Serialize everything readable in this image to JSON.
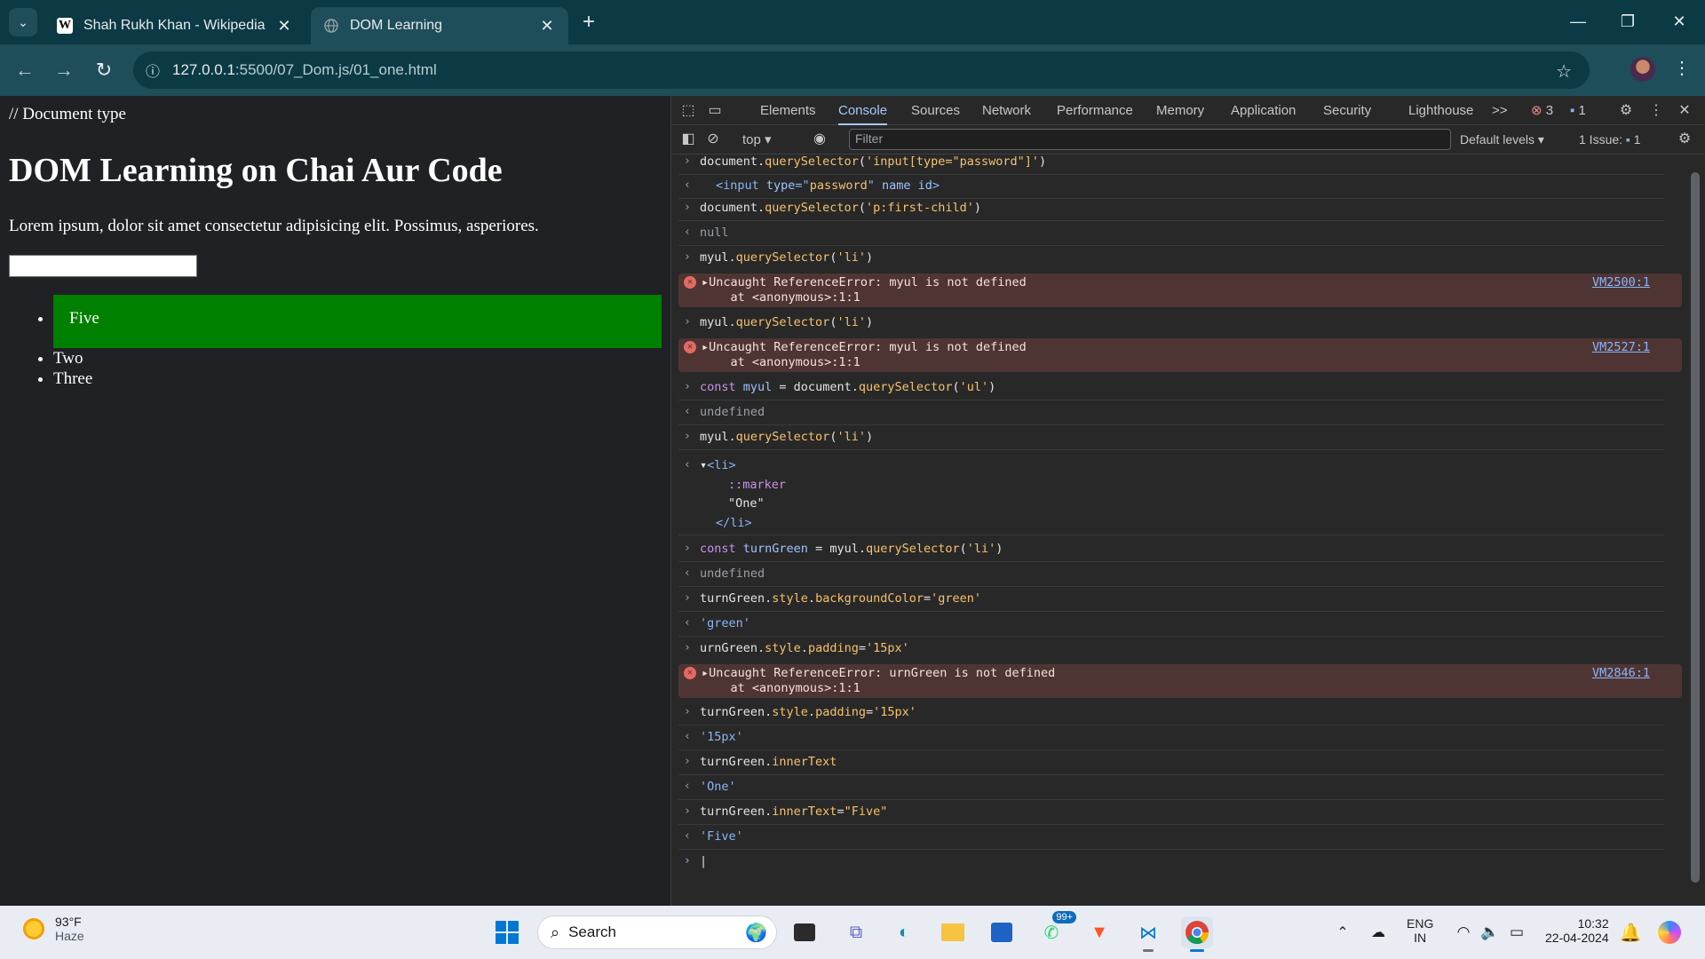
{
  "browser": {
    "tabs": [
      {
        "title": "Shah Rukh Khan - Wikipedia",
        "favicon": "W",
        "active": false
      },
      {
        "title": "DOM Learning",
        "favicon": "globe-icon",
        "active": true
      }
    ],
    "url_host": "127.0.0.1",
    "url_path": ":5500/07_Dom.js/01_one.html"
  },
  "page": {
    "doctype_text": "// Document type",
    "heading": "DOM Learning on Chai Aur Code",
    "paragraph": "Lorem ipsum, dolor sit amet consectetur adipisicing elit. Possimus, asperiores.",
    "list": [
      "Five",
      "Two",
      "Three"
    ],
    "first_item_bg": "#008000"
  },
  "devtools": {
    "tabs": [
      "Elements",
      "Console",
      "Sources",
      "Network",
      "Performance",
      "Memory",
      "Application",
      "Security",
      "Lighthouse"
    ],
    "more": ">>",
    "error_count": "3",
    "message_count": "1",
    "context": "top",
    "filter_placeholder": "Filter",
    "levels": "Default levels",
    "issues_label": "1 Issue:",
    "issues_count": "1",
    "console": {
      "r1": {
        "a": "document.",
        "b": "querySelector",
        "c": "(",
        "d": "'input[type=\"password\"]'",
        "e": ")"
      },
      "r2": {
        "a": "<input ",
        "b": "type",
        "c": "=\"",
        "d": "password",
        "e": "\" ",
        "f": "name id",
        "g": ">"
      },
      "r3": {
        "a": "document.",
        "b": "querySelector",
        "c": "(",
        "d": "'p:first-child'",
        "e": ")"
      },
      "r4": "null",
      "r5": {
        "a": "myul.",
        "b": "querySelector",
        "c": "(",
        "d": "'li'",
        "e": ")"
      },
      "e1": {
        "line1": "Uncaught ReferenceError: myul is not defined",
        "line2": "    at <anonymous>:1:1",
        "link": "VM2500:1"
      },
      "r6": {
        "a": "myul.",
        "b": "querySelector",
        "c": "(",
        "d": "'li'",
        "e": ")"
      },
      "e2": {
        "line1": "Uncaught ReferenceError: myul is not defined",
        "line2": "    at <anonymous>:1:1",
        "link": "VM2527:1"
      },
      "r7": {
        "kw": "const ",
        "v": "myul",
        "a": " = document.",
        "b": "querySelector",
        "c": "(",
        "d": "'ul'",
        "e": ")"
      },
      "r8": "undefined",
      "r9": {
        "a": "myul.",
        "b": "querySelector",
        "c": "(",
        "d": "'li'",
        "e": ")"
      },
      "r10": {
        "open": "<li>",
        "marker": "::marker",
        "text": "\"One\"",
        "close": "</li>"
      },
      "r11": {
        "kw": "const ",
        "v": "turnGreen",
        "a": " = myul.",
        "b": "querySelector",
        "c": "(",
        "d": "'li'",
        "e": ")"
      },
      "r12": "undefined",
      "r13": {
        "a": "turnGreen.",
        "b": "style",
        "c": ".",
        "d": "backgroundColor",
        "e": "=",
        "f": "'green'"
      },
      "r14": "'green'",
      "r15": {
        "a": "urnGreen.",
        "b": "style",
        "c": ".",
        "d": "padding",
        "e": "=",
        "f": "'15px'"
      },
      "e3": {
        "line1": "Uncaught ReferenceError: urnGreen is not defined",
        "line2": "    at <anonymous>:1:1",
        "link": "VM2846:1"
      },
      "r16": {
        "a": "turnGreen.",
        "b": "style",
        "c": ".",
        "d": "padding",
        "e": "=",
        "f": "'15px'"
      },
      "r17": "'15px'",
      "r18": {
        "a": "turnGreen.",
        "b": "innerText"
      },
      "r19": "'One'",
      "r20": {
        "a": "turnGreen.",
        "b": "innerText",
        "c": "=",
        "d": "\"Five\""
      },
      "r21": "'Five'"
    }
  },
  "taskbar": {
    "temp": "93°F",
    "condition": "Haze",
    "search_placeholder": "Search",
    "whatsapp_badge": "99+",
    "lang1": "ENG",
    "lang2": "IN",
    "time": "10:32",
    "date": "22-04-2024"
  }
}
